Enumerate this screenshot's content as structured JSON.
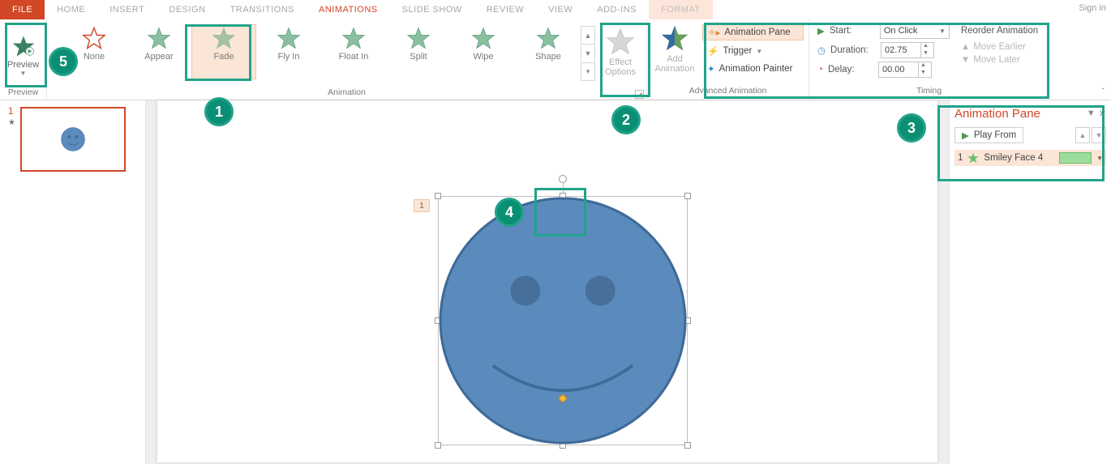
{
  "signin": "Sign in",
  "tabs": {
    "file": "FILE",
    "home": "HOME",
    "insert": "INSERT",
    "design": "DESIGN",
    "transitions": "TRANSITIONS",
    "animations": "ANIMATIONS",
    "slideshow": "SLIDE SHOW",
    "review": "REVIEW",
    "view": "VIEW",
    "addins": "ADD-INS",
    "format": "FORMAT"
  },
  "ribbon": {
    "preview": {
      "btn": "Preview",
      "group": "Preview"
    },
    "gallery": {
      "group": "Animation",
      "items": [
        {
          "label": "None"
        },
        {
          "label": "Appear"
        },
        {
          "label": "Fade"
        },
        {
          "label": "Fly In"
        },
        {
          "label": "Float In"
        },
        {
          "label": "Split"
        },
        {
          "label": "Wipe"
        },
        {
          "label": "Shape"
        }
      ],
      "effect_options": "Effect Options"
    },
    "advanced": {
      "group": "Advanced Animation",
      "add": "Add Animation",
      "pane": "Animation Pane",
      "trigger": "Trigger",
      "painter": "Animation Painter"
    },
    "timing": {
      "group": "Timing",
      "start_lbl": "Start:",
      "start_val": "On Click",
      "duration_lbl": "Duration:",
      "duration_val": "02.75",
      "delay_lbl": "Delay:",
      "delay_val": "00.00",
      "reorder": "Reorder Animation",
      "earlier": "Move Earlier",
      "later": "Move Later"
    }
  },
  "thumb": {
    "num": "1"
  },
  "shape": {
    "tag": "1"
  },
  "anim_pane": {
    "title": "Animation Pane",
    "play": "Play From",
    "entry_num": "1",
    "entry_name": "Smiley Face 4"
  },
  "callouts": {
    "c1": "1",
    "c2": "2",
    "c3": "3",
    "c4": "4",
    "c5": "5"
  }
}
